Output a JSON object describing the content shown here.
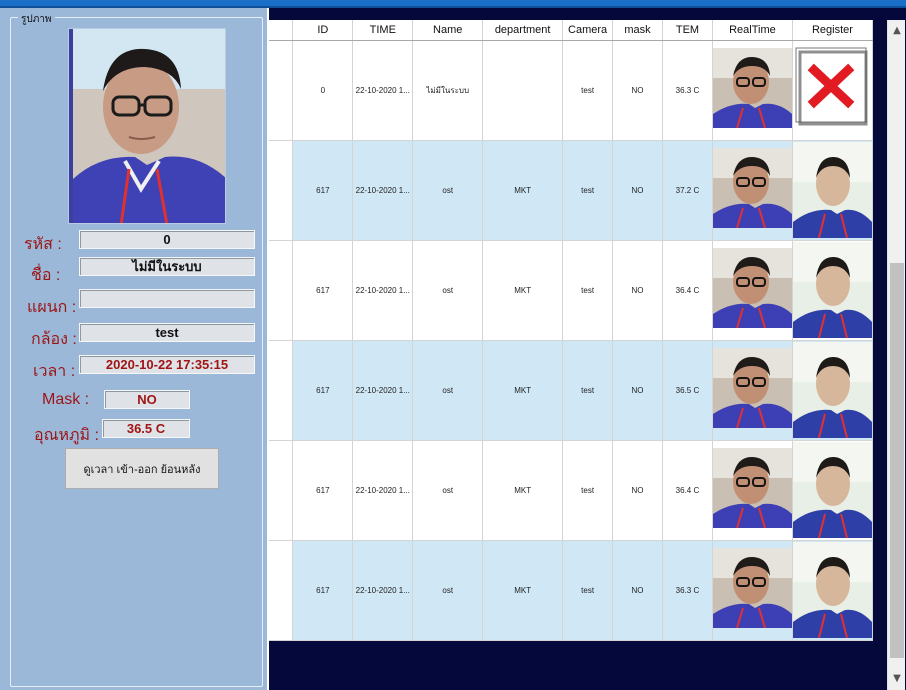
{
  "left_panel": {
    "group_title": "รูปภาพ",
    "fields": [
      {
        "label": "รหัส :",
        "value": "0"
      },
      {
        "label": "ชื่อ :",
        "value": "ไม่มีในระบบ"
      },
      {
        "label": "แผนก :",
        "value": ""
      },
      {
        "label": "กล้อง :",
        "value": "test"
      },
      {
        "label": "เวลา :",
        "value": "2020-10-22 17:35:15"
      },
      {
        "label": "Mask :",
        "value": "NO"
      },
      {
        "label": "อุณหภูมิ :",
        "value": "36.5 C"
      }
    ],
    "history_button": "ดูเวลา เข้า-ออก ย้อนหลัง"
  },
  "table": {
    "columns": [
      "ID",
      "TIME",
      "Name",
      "department",
      "Camera",
      "mask",
      "TEM",
      "RealTime",
      "Register"
    ],
    "rows": [
      {
        "id": "0",
        "time": "22-10-2020 1...",
        "name": "ไม่มีในระบบ",
        "department": "",
        "camera": "test",
        "mask": "NO",
        "tem": "36.3 C",
        "register": "none"
      },
      {
        "id": "617",
        "time": "22-10-2020 1...",
        "name": "ost",
        "department": "MKT",
        "camera": "test",
        "mask": "NO",
        "tem": "37.2 C",
        "register": "photo"
      },
      {
        "id": "617",
        "time": "22-10-2020 1...",
        "name": "ost",
        "department": "MKT",
        "camera": "test",
        "mask": "NO",
        "tem": "36.4 C",
        "register": "photo"
      },
      {
        "id": "617",
        "time": "22-10-2020 1...",
        "name": "ost",
        "department": "MKT",
        "camera": "test",
        "mask": "NO",
        "tem": "36.5 C",
        "register": "photo"
      },
      {
        "id": "617",
        "time": "22-10-2020 1...",
        "name": "ost",
        "department": "MKT",
        "camera": "test",
        "mask": "NO",
        "tem": "36.4 C",
        "register": "photo"
      },
      {
        "id": "617",
        "time": "22-10-2020 1...",
        "name": "ost",
        "department": "MKT",
        "camera": "test",
        "mask": "NO",
        "tem": "36.3 C",
        "register": "photo"
      }
    ]
  },
  "colors": {
    "panel_bg": "#9cb8d8",
    "label_red": "#9b1515",
    "row_alt": "#d0e8f6",
    "grid_bg": "#05083a",
    "title_bar": "#1a6fc9"
  },
  "icons": {
    "register_missing": "red-x-icon",
    "scroll_up": "chevron-up-icon",
    "scroll_down": "chevron-down-icon"
  }
}
